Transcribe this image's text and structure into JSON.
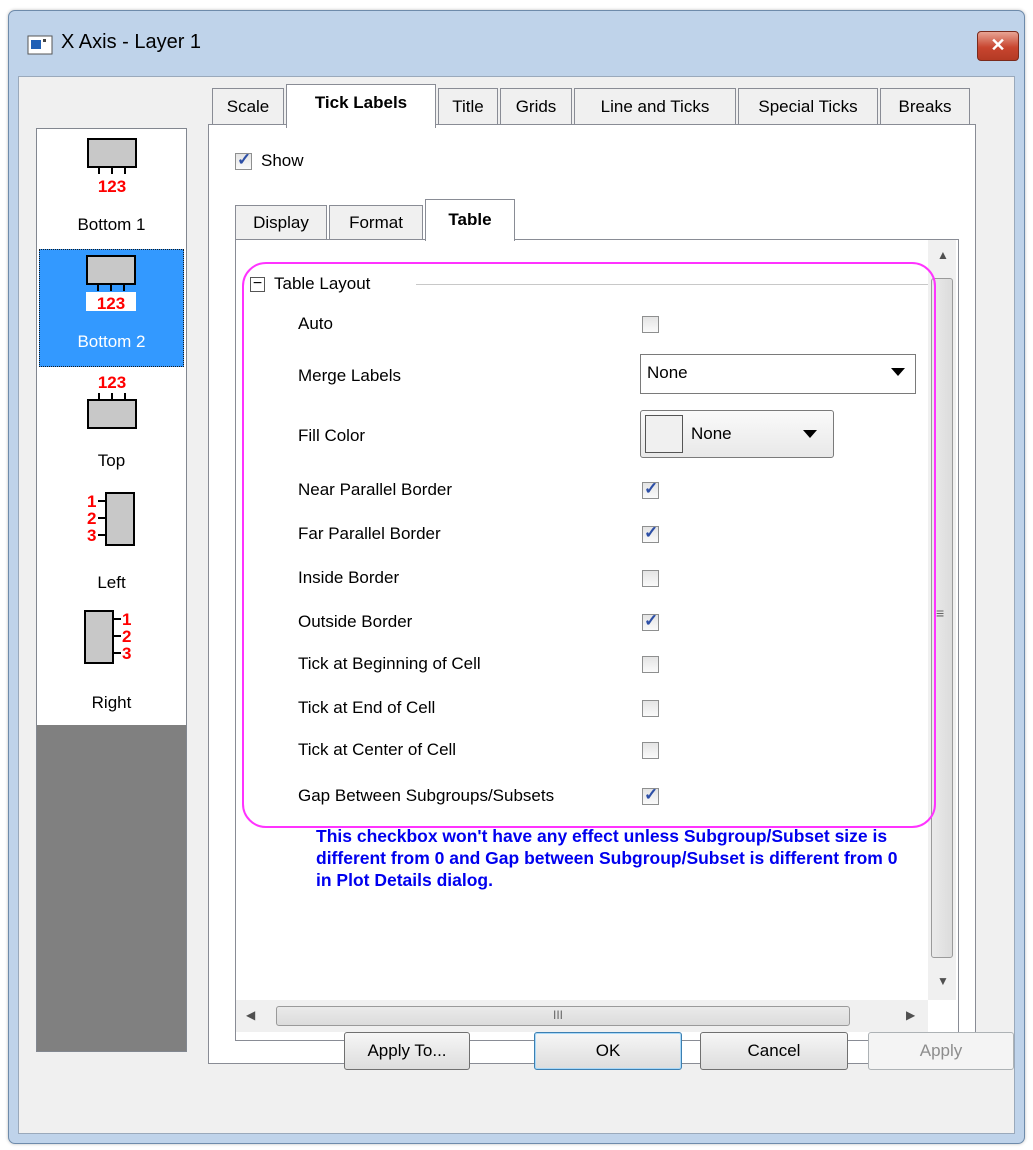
{
  "window": {
    "title": "X Axis - Layer 1",
    "close_label": "✕"
  },
  "sidebar": {
    "items": [
      {
        "label": "Bottom 1",
        "digits": "123",
        "selected": false
      },
      {
        "label": "Bottom 2",
        "digits": "123",
        "selected": true
      },
      {
        "label": "Top",
        "digits": "123",
        "selected": false
      },
      {
        "label": "Left",
        "digits": "123",
        "selected": false
      },
      {
        "label": "Right",
        "digits": "123",
        "selected": false
      }
    ]
  },
  "tabs": [
    "Scale",
    "Tick Labels",
    "Title",
    "Grids",
    "Line and Ticks",
    "Special Ticks",
    "Breaks"
  ],
  "active_tab": "Tick Labels",
  "show": {
    "label": "Show",
    "checked": true
  },
  "subtabs": [
    "Display",
    "Format",
    "Table"
  ],
  "active_subtab": "Table",
  "group": {
    "toggle": "−",
    "label": "Table Layout",
    "rows": [
      {
        "label": "Auto",
        "type": "checkbox",
        "checked": false
      },
      {
        "label": "Merge Labels",
        "type": "combo",
        "value": "None"
      },
      {
        "label": "Fill Color",
        "type": "color",
        "value": "None"
      },
      {
        "label": "Near Parallel Border",
        "type": "checkbox",
        "checked": true
      },
      {
        "label": "Far Parallel Border",
        "type": "checkbox",
        "checked": true
      },
      {
        "label": "Inside Border",
        "type": "checkbox",
        "checked": false
      },
      {
        "label": "Outside Border",
        "type": "checkbox",
        "checked": true
      },
      {
        "label": "Tick at Beginning of Cell",
        "type": "checkbox",
        "checked": false
      },
      {
        "label": "Tick at End of Cell",
        "type": "checkbox",
        "checked": false
      },
      {
        "label": "Tick at Center of Cell",
        "type": "checkbox",
        "checked": false
      },
      {
        "label": "Gap Between Subgroups/Subsets",
        "type": "checkbox",
        "checked": true
      }
    ]
  },
  "note": "This checkbox won't have any effect unless Subgroup/Subset size is different from 0 and Gap between Subgroup/Subset is different from 0 in Plot Details dialog.",
  "buttons": {
    "apply_to": "Apply To...",
    "ok": "OK",
    "cancel": "Cancel",
    "apply": "Apply"
  },
  "scroll": {
    "vthumb_glyph": "≡",
    "hthumb_glyph": "III"
  },
  "colors": {
    "highlight": "#ff33ff",
    "note": "#0000ee",
    "selection": "#3399ff",
    "tick_digits": "#ff0000"
  }
}
